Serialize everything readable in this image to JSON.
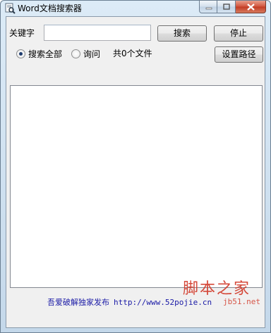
{
  "window": {
    "title": "Word文档搜索器",
    "app_icon": "magnifier-document-icon",
    "controls": [
      "minimize-icon",
      "maximize-icon",
      "close-icon"
    ]
  },
  "search": {
    "keyword_label": "关键字",
    "keyword_value": "",
    "search_button": "搜索",
    "stop_button": "停止",
    "set_path_button": "设置路径"
  },
  "options": {
    "search_all_label": "搜索全部",
    "search_all_checked": true,
    "query_label": "询问",
    "query_checked": false,
    "file_count": "共0个文件"
  },
  "results": {
    "items": []
  },
  "footer": {
    "publisher": "吾爱破解独家发布",
    "url": "http://www.52pojie.cn"
  },
  "watermark": {
    "brand": "脚本之家",
    "site": "jb51.net"
  }
}
